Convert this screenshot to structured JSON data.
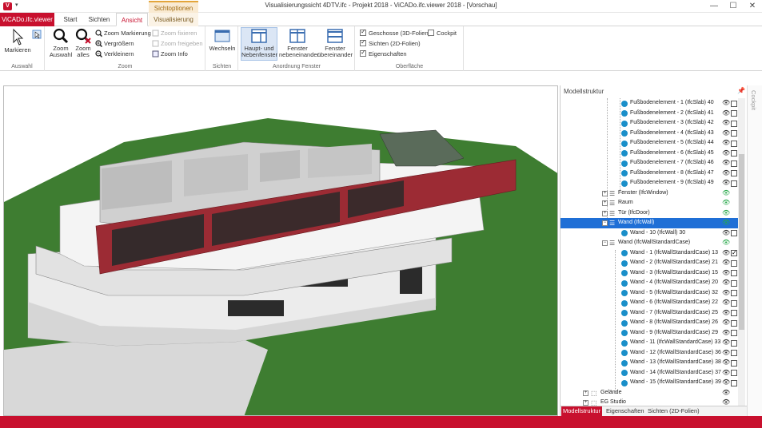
{
  "window": {
    "title": "Visualisierungssicht 4DTV.ifc - Projekt 2018 - ViCADo.ifc.viewer 2018 - [Vorschau]",
    "app_icon": "V",
    "minimize": "—",
    "maximize": "☐",
    "close": "✕"
  },
  "ribbon_tabs": {
    "file": "ViCADo.ifc.viewer",
    "start": "Start",
    "sichten": "Sichten",
    "ansicht": "Ansicht",
    "context_header": "Sichtoptionen",
    "visualisierung": "Visualisierung"
  },
  "ribbon": {
    "auswahl": {
      "label": "Auswahl",
      "markieren": "Markieren"
    },
    "zoom": {
      "label": "Zoom",
      "zoom_auswahl": [
        "Zoom",
        "Auswahl"
      ],
      "zoom_alles": [
        "Zoom",
        "alles"
      ],
      "zoom_markierung": "Zoom Markierung",
      "vergroessern": "Vergrößern",
      "verkleinern": "Verkleinern",
      "zoom_fixieren": "Zoom fixieren",
      "zoom_freigeben": "Zoom freigeben",
      "zoom_info": "Zoom Info"
    },
    "sichten": {
      "label": "Sichten",
      "wechseln": "Wechseln"
    },
    "anordnung": {
      "label": "Anordnung Fenster",
      "haupt": [
        "Haupt- und",
        "Nebenfenster"
      ],
      "nebeneinander": [
        "Fenster",
        "nebeneinander"
      ],
      "uebereinander": [
        "Fenster",
        "übereinander"
      ]
    },
    "oberflaeche": {
      "label": "Oberfläche",
      "geschosse": "Geschosse (3D-Folien)",
      "sichten": "Sichten (2D-Folien)",
      "eigenschaften": "Eigenschaften",
      "cockpit": "Cockpit"
    }
  },
  "panel": {
    "title": "Modellstruktur",
    "tabs": [
      "Modellstruktur",
      "Eigenschaften",
      "Sichten (2D-Folien)"
    ],
    "rows": [
      {
        "label": "Fußbodenelement - 1 (IfcSlab) 40",
        "kind": "item",
        "checked": false
      },
      {
        "label": "Fußbodenelement - 2 (IfcSlab) 41",
        "kind": "item",
        "checked": false
      },
      {
        "label": "Fußbodenelement - 3 (IfcSlab) 42",
        "kind": "item",
        "checked": false
      },
      {
        "label": "Fußbodenelement - 4 (IfcSlab) 43",
        "kind": "item",
        "checked": false
      },
      {
        "label": "Fußbodenelement - 5 (IfcSlab) 44",
        "kind": "item",
        "checked": false
      },
      {
        "label": "Fußbodenelement - 6 (IfcSlab) 45",
        "kind": "item",
        "checked": false
      },
      {
        "label": "Fußbodenelement - 7 (IfcSlab) 46",
        "kind": "item",
        "checked": false
      },
      {
        "label": "Fußbodenelement - 8 (IfcSlab) 47",
        "kind": "item",
        "checked": false
      },
      {
        "label": "Fußbodenelement - 9 (IfcSlab) 49",
        "kind": "item",
        "checked": false
      },
      {
        "label": "Fenster (IfcWindow)",
        "kind": "group",
        "checked": false
      },
      {
        "label": "Raum",
        "kind": "group",
        "checked": false
      },
      {
        "label": "Tür (IfcDoor)",
        "kind": "group",
        "checked": false
      },
      {
        "label": "Wand (IfcWall)",
        "kind": "group-open-selected",
        "checked": false
      },
      {
        "label": "Wand - 10 (IfcWall) 30",
        "kind": "item",
        "checked": false
      },
      {
        "label": "Wand (IfcWallStandardCase)",
        "kind": "group-open",
        "checked": false
      },
      {
        "label": "Wand - 1 (IfcWallStandardCase) 13",
        "kind": "item",
        "checked": true
      },
      {
        "label": "Wand - 2 (IfcWallStandardCase) 21",
        "kind": "item",
        "checked": false
      },
      {
        "label": "Wand - 3 (IfcWallStandardCase) 15",
        "kind": "item",
        "checked": false
      },
      {
        "label": "Wand - 4 (IfcWallStandardCase) 20",
        "kind": "item",
        "checked": false
      },
      {
        "label": "Wand - 5 (IfcWallStandardCase) 32",
        "kind": "item",
        "checked": false
      },
      {
        "label": "Wand - 6 (IfcWallStandardCase) 22",
        "kind": "item",
        "checked": false
      },
      {
        "label": "Wand - 7 (IfcWallStandardCase) 25",
        "kind": "item",
        "checked": false
      },
      {
        "label": "Wand - 8 (IfcWallStandardCase) 26",
        "kind": "item",
        "checked": false
      },
      {
        "label": "Wand - 9 (IfcWallStandardCase) 29",
        "kind": "item",
        "checked": false
      },
      {
        "label": "Wand - 11 (IfcWallStandardCase) 33",
        "kind": "item",
        "checked": false
      },
      {
        "label": "Wand - 12 (IfcWallStandardCase) 36",
        "kind": "item",
        "checked": false
      },
      {
        "label": "Wand - 13 (IfcWallStandardCase) 38",
        "kind": "item",
        "checked": false
      },
      {
        "label": "Wand - 14 (IfcWallStandardCase) 37",
        "kind": "item",
        "checked": false
      },
      {
        "label": "Wand - 15 (IfcWallStandardCase) 39",
        "kind": "item",
        "checked": false
      },
      {
        "label": "Gelände",
        "kind": "root",
        "checked": false
      },
      {
        "label": "EG Studio",
        "kind": "root",
        "checked": false
      }
    ]
  },
  "cockpit_strip": "Cockpit",
  "colors": {
    "accent": "#c8102e",
    "selection": "#1f6fd6",
    "grass": "#3e7d31",
    "wall_red": "#9c2b34"
  }
}
